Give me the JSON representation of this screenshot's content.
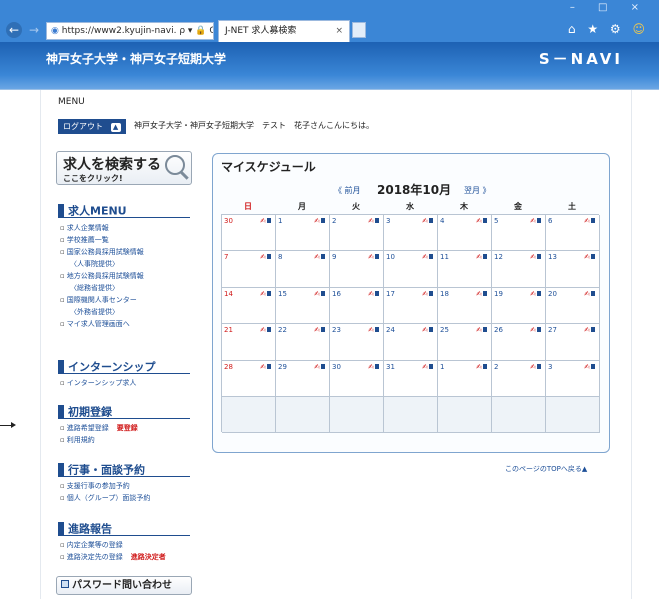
{
  "browser": {
    "address": "https://www2.kyujin-navi.",
    "address_icons": "ρ ▾ 🔒 C",
    "tab_title": "J-NET 求人募検索",
    "window_controls": "– □ ×",
    "tool_icons": "⌂ ★ ⚙"
  },
  "site": {
    "name": "神戸女子大学・神戸女子短期大学",
    "logo": "S－NAVI"
  },
  "top": {
    "menu_label": "MENU",
    "logout_label": "ログアウト",
    "welcome": "神戸女子大学・神戸女子短期大学　テスト　花子さんこんにちは。"
  },
  "sidebar": {
    "search_title": "求人を検索する",
    "search_sub": "ここをクリック!",
    "sections": [
      {
        "title": "求人MENU",
        "links": [
          "求人企業情報",
          "学校推薦一覧",
          "国家公務員採用試験情報",
          "〈人事院提供〉",
          "地方公務員採用試験情報",
          "〈総務省提供〉",
          "国際機関人事センター",
          "〈外務省提供〉",
          "マイ求人管理画面へ"
        ]
      },
      {
        "title": "インターンシップ",
        "links": [
          "インターンシップ求人"
        ]
      },
      {
        "title": "初期登録",
        "links": [
          "進路希望登録",
          "利用規約"
        ],
        "tag": "要登録"
      },
      {
        "title": "行事・面談予約",
        "links": [
          "支援行事の参加予約",
          "個人（グループ）面談予約"
        ]
      },
      {
        "title": "進路報告",
        "links": [
          "内定企業等の登録",
          "進路決定先の登録"
        ],
        "tag": "進路決定者"
      }
    ],
    "password_button": "パスワード問い合わせ"
  },
  "schedule": {
    "title": "マイスケジュール",
    "prev": "《 前月",
    "month": "2018年10月",
    "next": "翌月 》",
    "weekdays": [
      "日",
      "月",
      "火",
      "水",
      "木",
      "金",
      "土"
    ],
    "weeks": [
      [
        "30",
        "1",
        "2",
        "3",
        "4",
        "5",
        "6"
      ],
      [
        "7",
        "8",
        "9",
        "10",
        "11",
        "12",
        "13"
      ],
      [
        "14",
        "15",
        "16",
        "17",
        "18",
        "19",
        "20"
      ],
      [
        "21",
        "22",
        "23",
        "24",
        "25",
        "26",
        "27"
      ],
      [
        "28",
        "29",
        "30",
        "31",
        "1",
        "2",
        "3"
      ]
    ],
    "page_top_link": "このページのTOPへ戻る▲"
  },
  "colors": {
    "brand_blue": "#1f4d8f",
    "header_blue": "#3b86d6",
    "link_blue": "#1d4f98",
    "sunday_red": "#d01a1a"
  }
}
